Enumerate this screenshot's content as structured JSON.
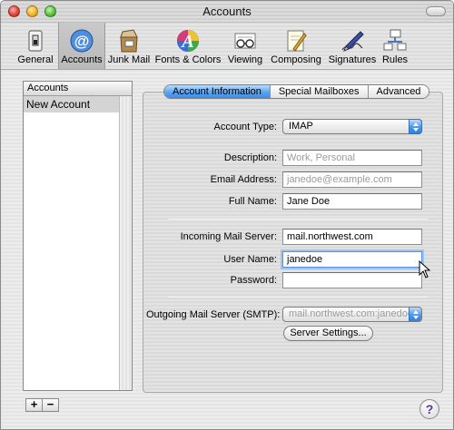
{
  "window": {
    "title": "Accounts"
  },
  "toolbar": {
    "items": [
      {
        "label": "General",
        "icon": "general-switch-icon"
      },
      {
        "label": "Accounts",
        "icon": "at-sign-icon",
        "active": true
      },
      {
        "label": "Junk Mail",
        "icon": "junk-mail-box-icon"
      },
      {
        "label": "Fonts & Colors",
        "icon": "fonts-colors-icon"
      },
      {
        "label": "Viewing",
        "icon": "viewing-glasses-icon"
      },
      {
        "label": "Composing",
        "icon": "composing-pencil-icon"
      },
      {
        "label": "Signatures",
        "icon": "signature-pen-icon"
      },
      {
        "label": "Rules",
        "icon": "rules-envelopes-icon"
      }
    ]
  },
  "accounts": {
    "header": "Accounts",
    "items": [
      "New Account"
    ],
    "add_label": "+",
    "remove_label": "−"
  },
  "tabs": {
    "items": [
      "Account Information",
      "Special Mailboxes",
      "Advanced"
    ],
    "active": "Account Information"
  },
  "form": {
    "account_type": {
      "label": "Account Type:",
      "value": "IMAP"
    },
    "description": {
      "label": "Description:",
      "value": "",
      "placeholder": "Work, Personal"
    },
    "email": {
      "label": "Email Address:",
      "value": "",
      "placeholder": "janedoe@example.com"
    },
    "full_name": {
      "label": "Full Name:",
      "value": "Jane Doe"
    },
    "incoming": {
      "label": "Incoming Mail Server:",
      "value": "mail.northwest.com"
    },
    "user_name": {
      "label": "User Name:",
      "value": "janedoe"
    },
    "password": {
      "label": "Password:",
      "value": ""
    },
    "smtp": {
      "label": "Outgoing Mail Server (SMTP):",
      "value": "mail.northwest.com:janedoe"
    },
    "server_settings_label": "Server Settings..."
  },
  "help": {
    "label": "?"
  },
  "colors": {
    "accent": "#3d8ee8",
    "focus_ring": "#9cc3f2"
  }
}
